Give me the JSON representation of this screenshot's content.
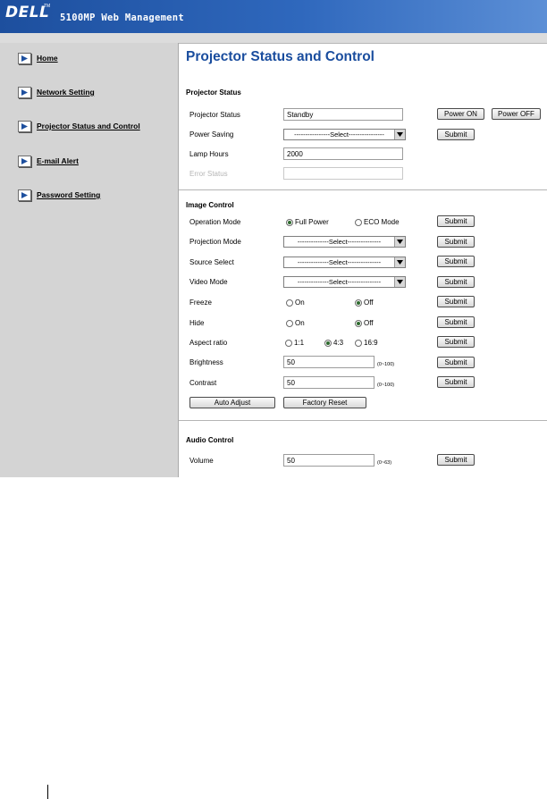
{
  "header": {
    "logo_text": "DELL",
    "logo_tm": "TM",
    "app_title": "5100MP Web Management"
  },
  "colors": {
    "banner": "#2f68bd",
    "title": "#1a4d9e",
    "sidebar_bg": "#d4d4d4"
  },
  "sidebar": {
    "items": [
      {
        "label": "Home",
        "icon": "play-arrow-icon"
      },
      {
        "label": "Network Setting",
        "icon": "play-arrow-icon"
      },
      {
        "label": "Projector Status and Control",
        "icon": "play-arrow-icon"
      },
      {
        "label": "E-mail Alert",
        "icon": "play-arrow-icon"
      },
      {
        "label": "Password Setting",
        "icon": "play-arrow-icon"
      }
    ]
  },
  "main": {
    "title": "Projector Status and Control",
    "projector_status": {
      "section_title": "Projector Status",
      "status_label": "Projector Status",
      "status_value": "Standby",
      "power_on": "Power ON",
      "power_off": "Power OFF",
      "power_saving_label": "Power Saving",
      "power_saving_value": "----------------Select----------------",
      "lamp_hours_label": "Lamp Hours",
      "lamp_hours_value": "2000",
      "error_status_label": "Error Status",
      "error_status_value": ""
    },
    "image_control": {
      "section_title": "Image Control",
      "operation_mode_label": "Operation Mode",
      "operation_mode_options": [
        "Full Power",
        "ECO Mode"
      ],
      "operation_mode_selected": "Full Power",
      "projection_mode_label": "Projection Mode",
      "projection_mode_value": "--------------Select---------------",
      "source_select_label": "Source Select",
      "source_select_value": "--------------Select---------------",
      "video_mode_label": "Video Mode",
      "video_mode_value": "--------------Select---------------",
      "freeze_label": "Freeze",
      "freeze_options": [
        "On",
        "Off"
      ],
      "freeze_selected": "Off",
      "hide_label": "Hide",
      "hide_options": [
        "On",
        "Off"
      ],
      "hide_selected": "Off",
      "aspect_label": "Aspect ratio",
      "aspect_options": [
        "1:1",
        "4:3",
        "16:9"
      ],
      "aspect_selected": "4:3",
      "brightness_label": "Brightness",
      "brightness_value": "50",
      "brightness_range": "(0~100)",
      "contrast_label": "Contrast",
      "contrast_value": "50",
      "contrast_range": "(0~100)",
      "auto_adjust": "Auto Adjust",
      "factory_reset": "Factory Reset"
    },
    "audio_control": {
      "section_title": "Audio  Control",
      "volume_label": "Volume",
      "volume_value": "50",
      "volume_range": "(0~63)"
    },
    "submit_label": "Submit"
  }
}
